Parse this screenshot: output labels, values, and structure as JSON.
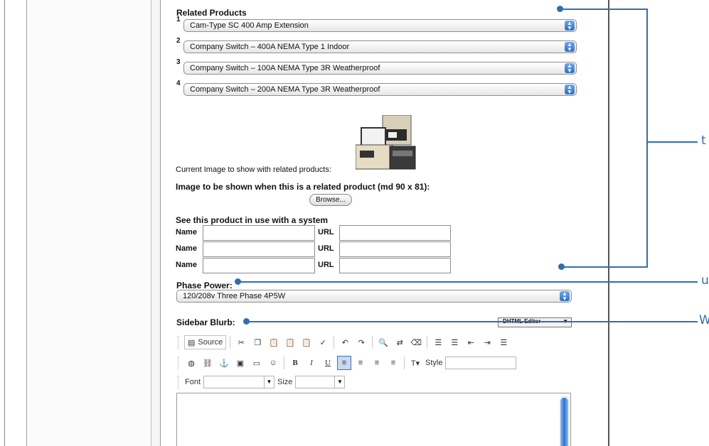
{
  "related": {
    "title": "Related Products",
    "items": [
      {
        "num": "1",
        "value": "Cam-Type SC 400 Amp Extension"
      },
      {
        "num": "2",
        "value": "Company Switch – 400A NEMA Type 1 Indoor"
      },
      {
        "num": "3",
        "value": "Company Switch – 100A NEMA Type 3R Weatherproof"
      },
      {
        "num": "4",
        "value": "Company Switch – 200A NEMA Type 3R Weatherproof"
      }
    ],
    "current_image_label": "Current Image to show with related products:",
    "image_prompt": "Image to be shown when this is a related product (md 90 x 81):",
    "browse_label": "Browse..."
  },
  "system": {
    "title": "See this product in use with a system",
    "rows": [
      {
        "name_label": "Name",
        "url_label": "URL"
      },
      {
        "name_label": "Name",
        "url_label": "URL"
      },
      {
        "name_label": "Name",
        "url_label": "URL"
      }
    ]
  },
  "phase": {
    "title": "Phase Power:",
    "value": "120/208v Three Phase 4P5W"
  },
  "sidebar_blurb": {
    "title": "Sidebar Blurb:",
    "editor_select": "DHTML Editor",
    "toolbar": {
      "source_label": "Source",
      "style_label": "Style",
      "font_label": "Font",
      "size_label": "Size"
    }
  },
  "callouts": {
    "t_label": "t",
    "u_label": "u",
    "w_label": "W"
  },
  "colors": {
    "callout": "#2f6db5",
    "select_arrow": "#2a6fcf"
  }
}
